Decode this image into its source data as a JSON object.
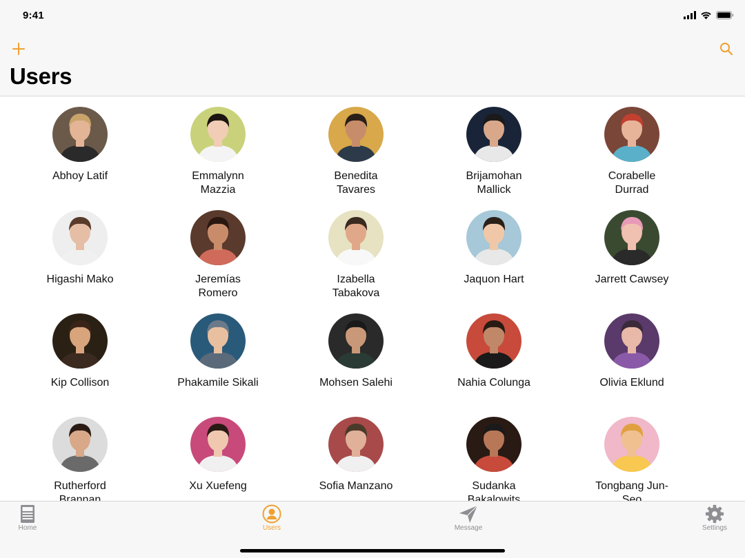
{
  "status_bar": {
    "time": "9:41",
    "icons": [
      "cellular-signal-icon",
      "wifi-icon",
      "battery-icon"
    ]
  },
  "nav_bar": {
    "title": "Users",
    "left_button_icon": "plus-icon",
    "right_button_icon": "search-icon"
  },
  "theme": {
    "accent": "#f0a030",
    "inactive": "#8e8e93",
    "bar_background": "#f7f7f7"
  },
  "users": [
    {
      "name": "Abhoy Latif",
      "bg": "#6b5a4a",
      "skin": "#e3b596",
      "hair": "#c9a36a",
      "shirt": "#2a2a2a"
    },
    {
      "name": "Emmalynn Mazzia",
      "bg": "#c9d27a",
      "skin": "#f0cdb4",
      "hair": "#1c1410",
      "shirt": "#f4f4f4"
    },
    {
      "name": "Benedita Tavares",
      "bg": "#d8a84a",
      "skin": "#c78d6a",
      "hair": "#2a1e18",
      "shirt": "#2c3a4a"
    },
    {
      "name": "Brijamohan Mallick",
      "bg": "#1a2438",
      "skin": "#d9a88a",
      "hair": "#1a1a1a",
      "shirt": "#e8e8e8"
    },
    {
      "name": "Corabelle Durrad",
      "bg": "#7a4638",
      "skin": "#e7b49a",
      "hair": "#c24030",
      "shirt": "#5ab0c8"
    },
    {
      "name": "Higashi Mako",
      "bg": "#eeeeee",
      "skin": "#e6bea6",
      "hair": "#5a3a2a",
      "shirt": "#f0f0f0"
    },
    {
      "name": "Jeremías Romero",
      "bg": "#5a3a2c",
      "skin": "#c98c6a",
      "hair": "#2a1810",
      "shirt": "#d06a5a"
    },
    {
      "name": "Izabella Tabakova",
      "bg": "#e6e2c2",
      "skin": "#e0a888",
      "hair": "#3a2a20",
      "shirt": "#f8f8f8"
    },
    {
      "name": "Jaquon Hart",
      "bg": "#a6c8d8",
      "skin": "#f0c8a8",
      "hair": "#2a2018",
      "shirt": "#e8e8e8"
    },
    {
      "name": "Jarrett Cawsey",
      "bg": "#3a4a30",
      "skin": "#f0c0b0",
      "hair": "#e89ab8",
      "shirt": "#2a2a2a"
    },
    {
      "name": "Kip Collison",
      "bg": "#2a2014",
      "skin": "#d8a47c",
      "hair": "#3a2418",
      "shirt": "#3a2a20"
    },
    {
      "name": "Phakamile Sikali",
      "bg": "#2a5a7a",
      "skin": "#e8c0a0",
      "hair": "#6a7a8a",
      "shirt": "#5a6a7a"
    },
    {
      "name": "Mohsen Salehi",
      "bg": "#2a2a2a",
      "skin": "#c89878",
      "hair": "#1a1a1a",
      "shirt": "#2a3a34"
    },
    {
      "name": "Nahia Colunga",
      "bg": "#c84a3a",
      "skin": "#c08868",
      "hair": "#2a1a14",
      "shirt": "#1a1a1a"
    },
    {
      "name": "Olivia Eklund",
      "bg": "#5a3a6a",
      "skin": "#e8b8a8",
      "hair": "#3a2a3a",
      "shirt": "#8a5aa8"
    },
    {
      "name": "Rutherford Brannan",
      "bg": "#dcdcdc",
      "skin": "#d8a888",
      "hair": "#2a1a14",
      "shirt": "#6a6a6a"
    },
    {
      "name": "Xu Xuefeng",
      "bg": "#c84a7a",
      "skin": "#f0c8b0",
      "hair": "#2a1a14",
      "shirt": "#f0f0f0"
    },
    {
      "name": "Sofia Manzano",
      "bg": "#a84a4a",
      "skin": "#e0b098",
      "hair": "#4a3a2a",
      "shirt": "#f0f0f0"
    },
    {
      "name": "Sudanka Bakalowits",
      "bg": "#2a1a14",
      "skin": "#b87858",
      "hair": "#1a1a1a",
      "shirt": "#c84a3a"
    },
    {
      "name": "Tongbang Jun-Seo",
      "bg": "#f0b8c8",
      "skin": "#f0c090",
      "hair": "#e0a040",
      "shirt": "#f8c850"
    }
  ],
  "tabs": [
    {
      "label": "Home",
      "icon": "home-icon",
      "active": false
    },
    {
      "label": "Users",
      "icon": "user-icon",
      "active": true
    },
    {
      "label": "Message",
      "icon": "paper-plane-icon",
      "active": false
    },
    {
      "label": "Settings",
      "icon": "gear-icon",
      "active": false
    }
  ]
}
